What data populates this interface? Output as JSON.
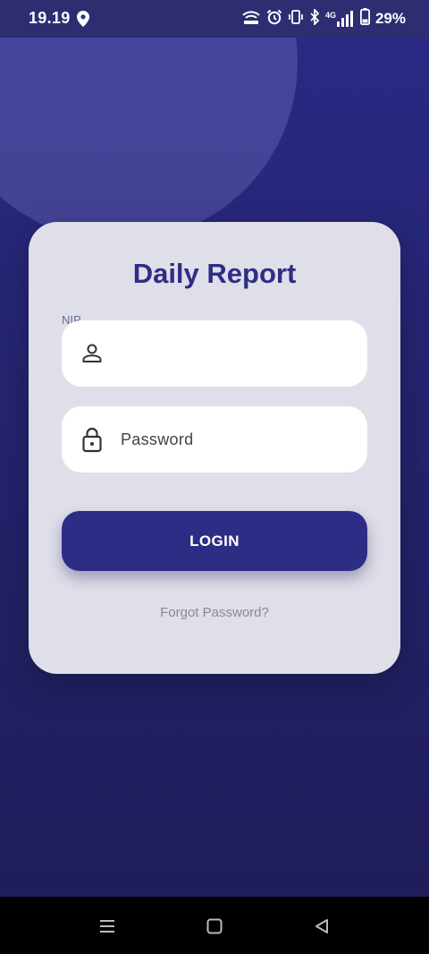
{
  "status": {
    "time": "19.19",
    "network_label": "4G",
    "battery": "29%"
  },
  "card": {
    "title": "Daily Report",
    "nip_label": "NIP",
    "nip_value": "",
    "password_placeholder": "Password",
    "login_label": "LOGIN",
    "forgot_label": "Forgot Password?"
  },
  "icons": {
    "status_left": "location-pin-icon",
    "status_right": [
      "hotspot-icon",
      "alarm-icon",
      "vibrate-icon",
      "bluetooth-icon",
      "signal-icon",
      "battery-icon"
    ],
    "nip_field": "user-icon",
    "password_field": "lock-icon",
    "nav": [
      "menu-icon",
      "home-icon",
      "back-icon"
    ]
  },
  "colors": {
    "primary": "#2e2d86",
    "background": "#25246f",
    "card": "#dfdfe9",
    "muted_text": "#8a8a96"
  }
}
